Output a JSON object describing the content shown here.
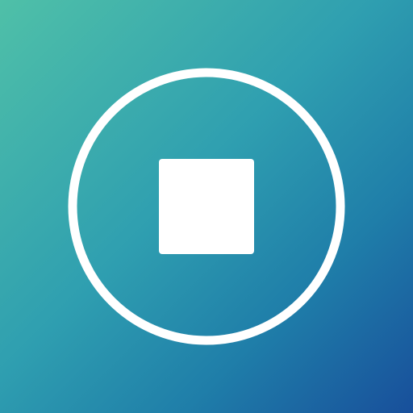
{
  "icon": {
    "name": "stop-icon",
    "ring": "circle-outline",
    "glyph": "square"
  },
  "colors": {
    "gradient_start": "#4fc0a8",
    "gradient_mid": "#2f9fb0",
    "gradient_end": "#184f9b",
    "foreground": "#ffffff"
  }
}
